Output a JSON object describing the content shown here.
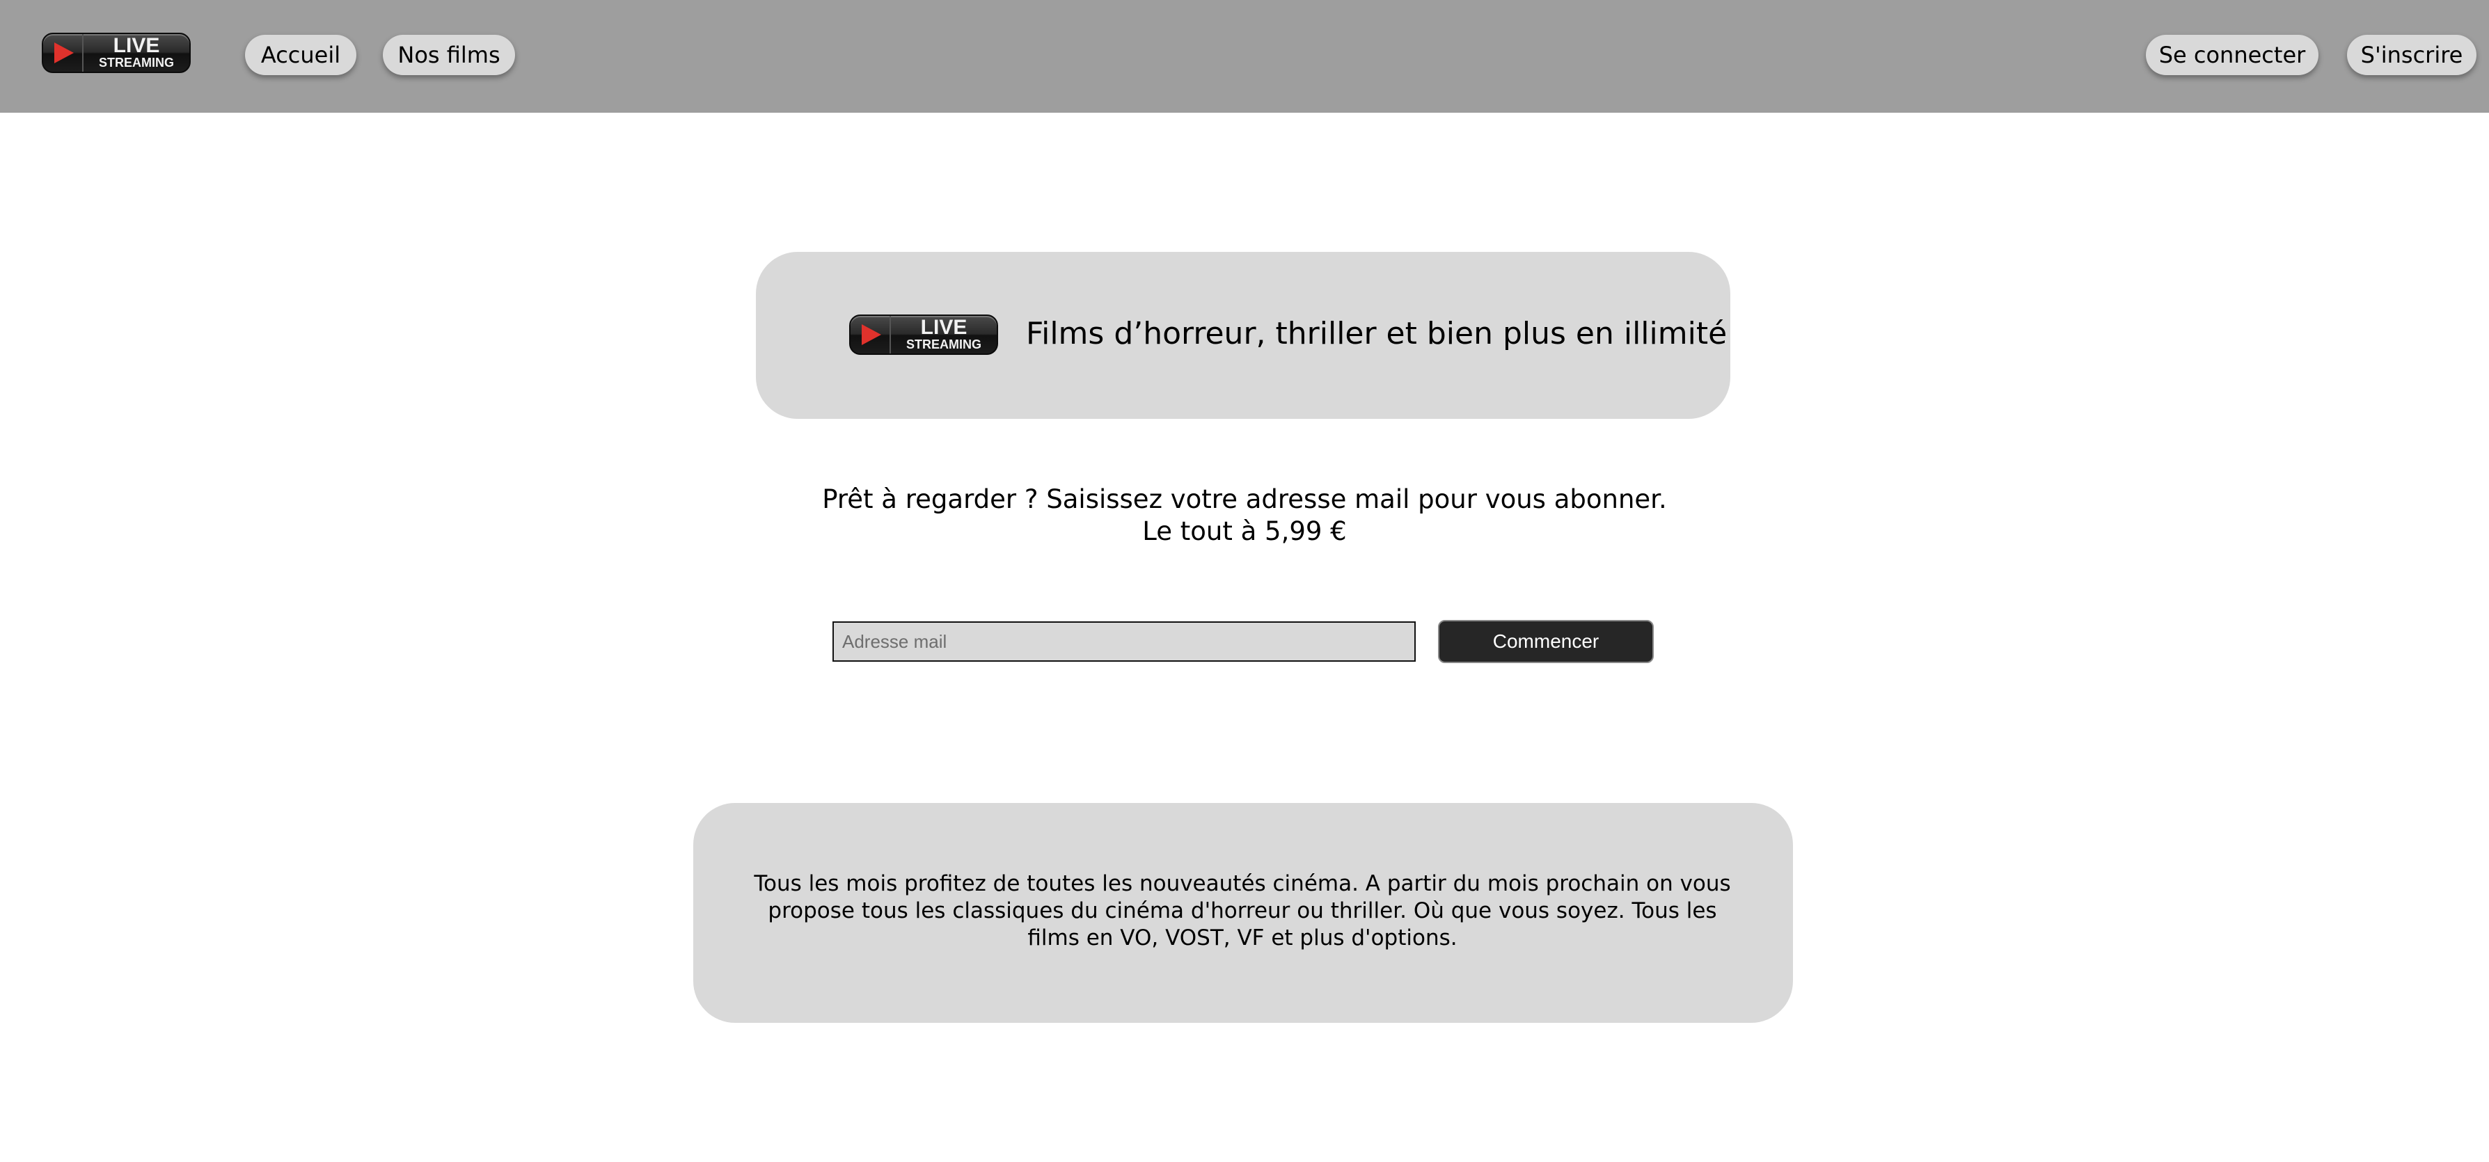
{
  "header": {
    "logo": {
      "line1": "LIVE",
      "line2": "STREAMING"
    },
    "nav": [
      {
        "label": "Accueil"
      },
      {
        "label": "Nos films"
      }
    ],
    "auth": {
      "login_label": "Se connecter",
      "signup_label": "S'inscrire"
    }
  },
  "hero": {
    "logo": {
      "line1": "LIVE",
      "line2": "STREAMING"
    },
    "title": "Films d’horreur, thriller et bien plus en illimité"
  },
  "cta": {
    "line1": "Prêt à regarder ? Saisissez votre adresse mail pour vous abonner.",
    "line2": "Le tout à 5,99 €"
  },
  "form": {
    "email_placeholder": "Adresse mail",
    "email_value": "",
    "submit_label": "Commencer"
  },
  "info": {
    "text": "Tous les mois profitez de toutes les nouveautés cinéma. A partir du mois prochain on vous propose tous les classiques du cinéma d'horreur ou thriller. Où que vous soyez. Tous les films en VO, VOST, VF et plus d'options."
  },
  "colors": {
    "header_bg": "#9e9e9e",
    "card_bg": "#d9d9d9",
    "button_dark": "#262626",
    "play_red": "#e0322c"
  }
}
